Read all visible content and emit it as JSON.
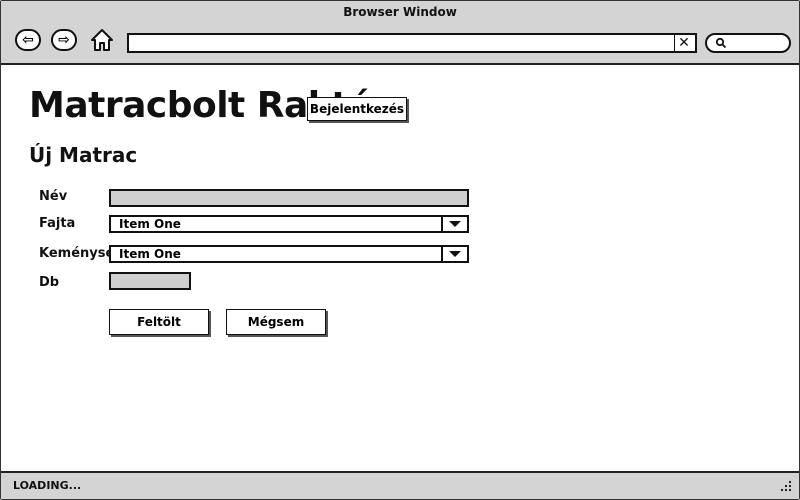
{
  "browser": {
    "title": "Browser Window",
    "url": "",
    "search_value": "",
    "status": "LOADING..."
  },
  "page": {
    "heading": "Matracbolt Raktár",
    "login_button": "Bejelentkezés",
    "subheading": "Új Matrac"
  },
  "form": {
    "name_label": "Név",
    "name_value": "",
    "type_label": "Fajta",
    "type_value": "Item One",
    "hardness_label": "Keménység",
    "hardness_value": "Item One",
    "qty_label": "Db",
    "qty_value": "",
    "submit_button": "Feltölt",
    "cancel_button": "Mégsem"
  }
}
